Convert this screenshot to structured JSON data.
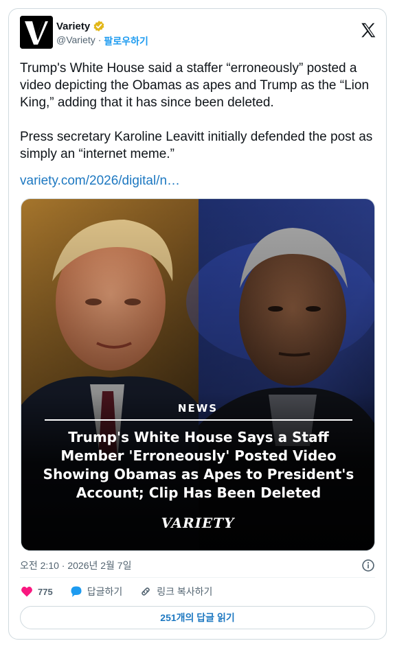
{
  "account": {
    "display_name": "Variety",
    "handle": "@Variety",
    "separator": "·",
    "follow_label": "팔로우하기"
  },
  "tweet": {
    "text": "Trump's White House said a staffer “erroneously” posted a video depicting the Obamas as apes and Trump as the “Lion King,” adding that it has since been deleted.\n\nPress secretary Karoline Leavitt initially defended the post as simply an “internet meme.”",
    "link": "variety.com/2026/digital/n…"
  },
  "media": {
    "news_tag": "NEWS",
    "headline": "Trump's White House Says a Staff Member 'Erroneously' Posted Video Showing Obamas as Apes to President's Account; Clip Has Been Deleted",
    "brand": "VARIETY"
  },
  "meta": {
    "timestamp": "오전 2:10 · 2026년 2월 7일"
  },
  "actions": {
    "like_count": "775",
    "reply_label": "답글하기",
    "copy_link_label": "링크 복사하기"
  },
  "replies_button": "251개의 답글 읽기",
  "colors": {
    "link": "#1d78c1",
    "like": "#f91880",
    "reply": "#1d9bf0",
    "verified": "#e2b719"
  },
  "icons": [
    "variety-logo-icon",
    "verified-badge-icon",
    "x-logo-icon",
    "info-icon",
    "heart-icon",
    "reply-icon",
    "link-icon"
  ]
}
